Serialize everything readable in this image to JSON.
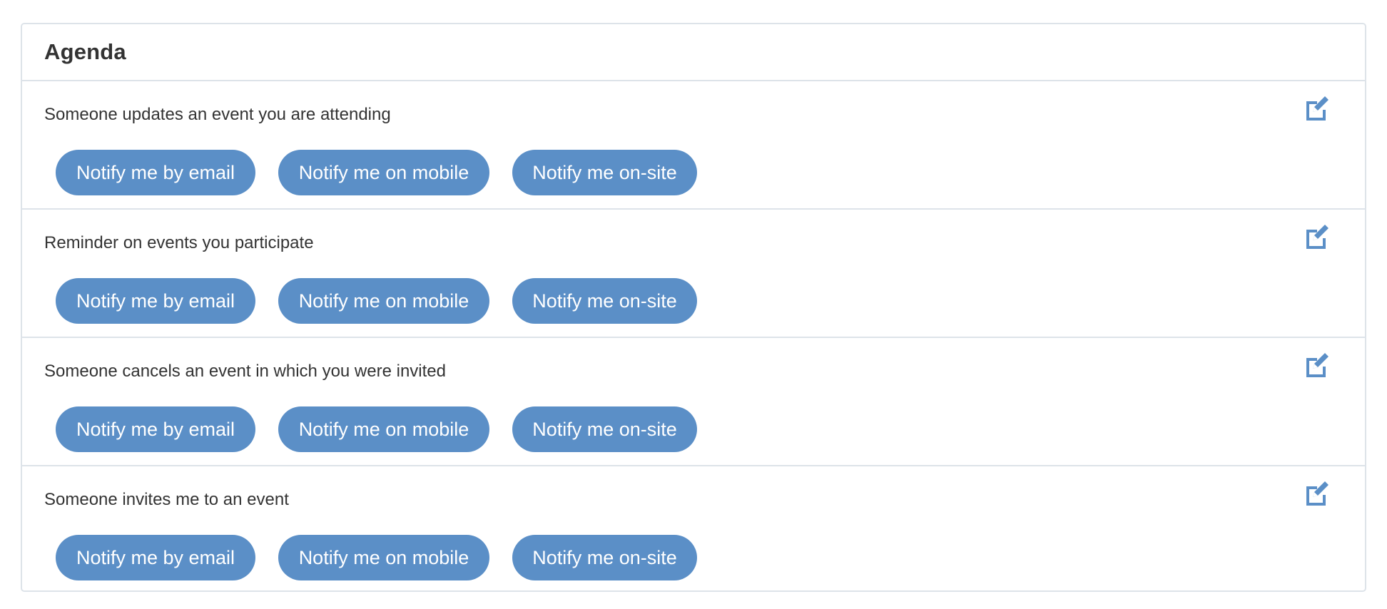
{
  "panel": {
    "title": "Agenda"
  },
  "icons": {
    "edit": "edit-icon",
    "accent_color": "#5b8fc7"
  },
  "rows": [
    {
      "label": "Someone updates an event you are attending",
      "buttons": [
        "Notify me by email",
        "Notify me on mobile",
        "Notify me on-site"
      ]
    },
    {
      "label": "Reminder on events you participate",
      "buttons": [
        "Notify me by email",
        "Notify me on mobile",
        "Notify me on-site"
      ]
    },
    {
      "label": "Someone cancels an event in which you were invited",
      "buttons": [
        "Notify me by email",
        "Notify me on mobile",
        "Notify me on-site"
      ]
    },
    {
      "label": "Someone invites me to an event",
      "buttons": [
        "Notify me by email",
        "Notify me on mobile",
        "Notify me on-site"
      ]
    }
  ]
}
